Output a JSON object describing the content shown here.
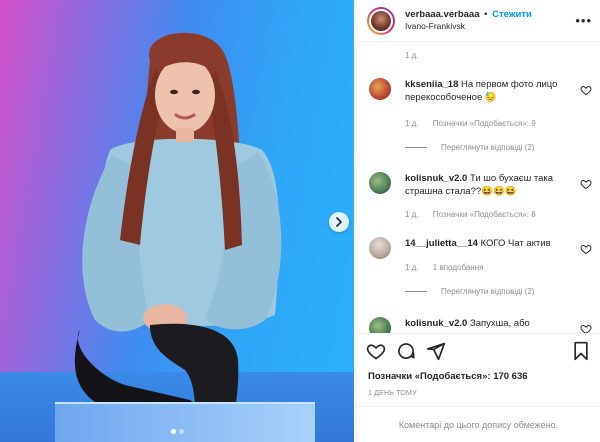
{
  "post": {
    "username": "verbaaa.verbaaa",
    "separator": "•",
    "follow_label": "Стежити",
    "location": "Ivano-Frankivsk",
    "more_label": "•••"
  },
  "comments_section": {
    "top_time": "1 д.",
    "items": [
      {
        "user": "kkseniia_18",
        "text": "На первом фото лицо перекособоченое 😓",
        "time": "1 д.",
        "likes": "Позначки «Подобається»: 9",
        "replies": "Переглянути відповіді (2)"
      },
      {
        "user": "kolisnuk_v2.0",
        "text": "Ти шо бухаєш така страшна стала??😆😆😆",
        "time": "1 д.",
        "likes": "Позначки «Подобається»: 8",
        "replies": ""
      },
      {
        "user": "14__julietta__14",
        "text": "КОГО Чат актив",
        "time": "1 д.",
        "likes": "1 вподобання",
        "replies": "Переглянути відповіді (2)"
      },
      {
        "user": "kolisnuk_v2.0",
        "text": "Запухша, або",
        "time": "",
        "likes": "",
        "replies": ""
      }
    ]
  },
  "actions": {
    "icons": [
      "heart-icon",
      "comment-icon",
      "share-icon",
      "bookmark-icon"
    ]
  },
  "likes_summary": "Позначки «Подобається»: 170 636",
  "post_date": "1 ДЕНЬ ТОМУ",
  "comments_disabled": "Коментарі до цього допису обмежено.",
  "colors": {
    "accent": "#0095f6",
    "text": "#262626",
    "muted": "#8e8e8e"
  }
}
